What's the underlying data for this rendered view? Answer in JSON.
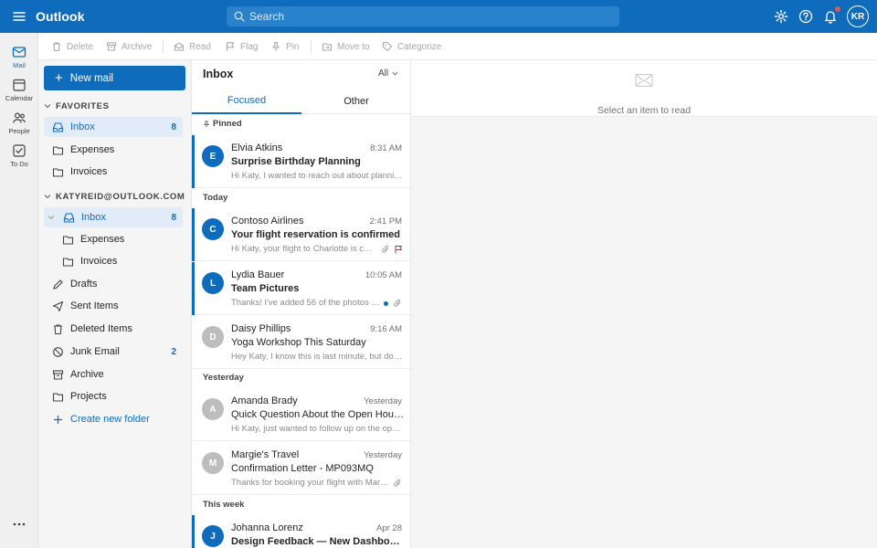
{
  "app": {
    "brand": "Outlook",
    "search_placeholder": "Search",
    "user_initials": "KR",
    "accent": "#0f6cbd"
  },
  "rail": [
    {
      "label": "Mail",
      "icon": "mail-icon",
      "active": true
    },
    {
      "label": "Calendar",
      "icon": "calendar-icon"
    },
    {
      "label": "People",
      "icon": "people-icon"
    },
    {
      "label": "To Do",
      "icon": "todo-icon"
    }
  ],
  "commands": {
    "delete": "Delete",
    "archive": "Archive",
    "read": "Read",
    "flag": "Flag",
    "pin": "Pin",
    "move": "Move to",
    "categorize": "Categorize"
  },
  "folders": {
    "new_mail": "New mail",
    "favorites_label": "FAVORITES",
    "favorites": [
      {
        "name": "Inbox",
        "count": "8"
      },
      {
        "name": "Expenses"
      },
      {
        "name": "Invoices"
      }
    ],
    "account_label": "KATYREID@OUTLOOK.COM",
    "account": [
      {
        "name": "Inbox",
        "count": "8"
      },
      {
        "name": "Expenses"
      },
      {
        "name": "Invoices"
      },
      {
        "name": "Drafts"
      },
      {
        "name": "Sent Items"
      },
      {
        "name": "Deleted Items"
      },
      {
        "name": "Junk Email",
        "count": "2"
      },
      {
        "name": "Archive"
      },
      {
        "name": "Projects"
      }
    ],
    "create_folder": "Create new folder"
  },
  "list": {
    "title": "Inbox",
    "filter": "All",
    "tabs": [
      "Focused",
      "Other"
    ],
    "groups": {
      "pinned": "Pinned",
      "today": "Today",
      "yesterday": "Yesterday",
      "this_week": "This week"
    },
    "messages": [
      {
        "initial": "E",
        "color": "#0f6cbd",
        "sender": "Elvia Atkins",
        "time": "8:31 AM",
        "subject": "Surprise Birthday Planning",
        "preview": "Hi Katy, I wanted to reach out about planni…"
      },
      {
        "initial": "C",
        "color": "#0f6cbd",
        "sender": "Contoso Airlines",
        "time": "2:41 PM",
        "subject": "Your flight reservation is confirmed",
        "preview": "Hi Katy, your flight to Charlotte is c…"
      },
      {
        "initial": "L",
        "color": "#0f6cbd",
        "sender": "Lydia Bauer",
        "time": "10:05 AM",
        "subject": "Team Pictures",
        "preview": "Thanks! I've added 56 of the photos …"
      },
      {
        "initial": "D",
        "color": "#bdbdbd",
        "sender": "Daisy Phillips",
        "time": "9:16 AM",
        "subject": "Yoga Workshop This Saturday",
        "preview": "Hey Katy, I know this is last minute, but do…"
      },
      {
        "initial": "A",
        "color": "#bdbdbd",
        "sender": "Amanda Brady",
        "time": "Yesterday",
        "subject": "Quick Question About the Open Hou…",
        "preview": "Hi Katy, just wanted to follow up on the op…"
      },
      {
        "initial": "M",
        "color": "#bdbdbd",
        "sender": "Margie's Travel",
        "time": "Yesterday",
        "subject": "Confirmation Letter - MP093MQ",
        "preview": "Thanks for booking your flight with Mar…"
      },
      {
        "initial": "J",
        "color": "#0f6cbd",
        "sender": "Johanna Lorenz",
        "time": "Apr 28",
        "subject": "Design Feedback — New Dashboar…",
        "preview": ""
      }
    ]
  },
  "reading": {
    "hint": "Select an item to read"
  }
}
